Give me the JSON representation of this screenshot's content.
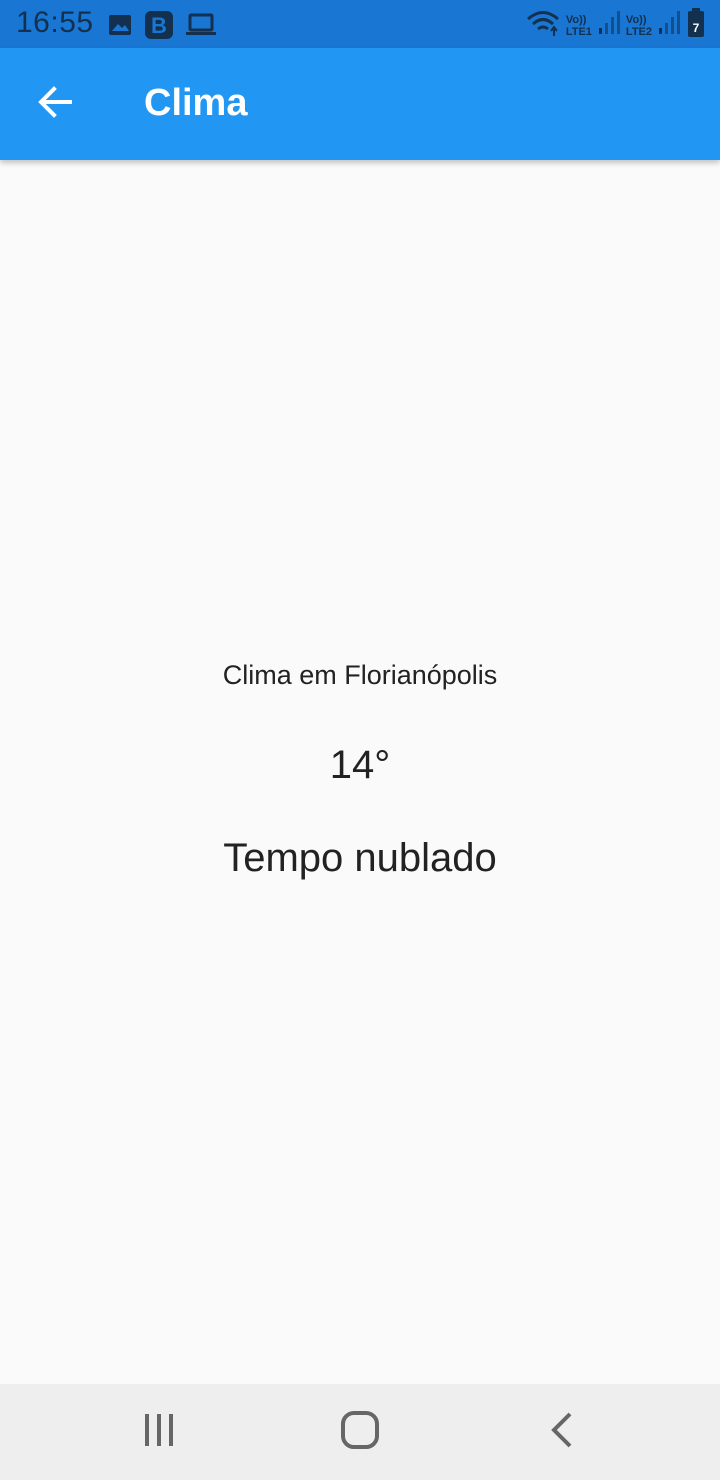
{
  "status_bar": {
    "time": "16:55",
    "left_icons": [
      "image-icon",
      "b-app-icon",
      "laptop-icon"
    ],
    "right_icons": [
      "wifi-icon",
      "signal-icon",
      "signal-icon",
      "battery-icon"
    ],
    "sim1_top": "Vo))",
    "sim1_bottom": "LTE1",
    "sim2_top": "Vo))",
    "sim2_bottom": "LTE2",
    "battery_level": "7",
    "colors": {
      "background": "#1976d2",
      "foreground": "#13304f"
    }
  },
  "app_bar": {
    "title": "Clima",
    "back_icon": "arrow-back-icon",
    "colors": {
      "background": "#2196f3",
      "foreground": "#ffffff"
    }
  },
  "weather": {
    "city_label": "Clima em Florianópolis",
    "temperature": "14°",
    "condition": "Tempo nublado"
  },
  "nav_bar": {
    "buttons": [
      "recent-apps-icon",
      "home-icon",
      "back-icon"
    ],
    "colors": {
      "background": "#eeeeee",
      "foreground": "#666666"
    }
  }
}
